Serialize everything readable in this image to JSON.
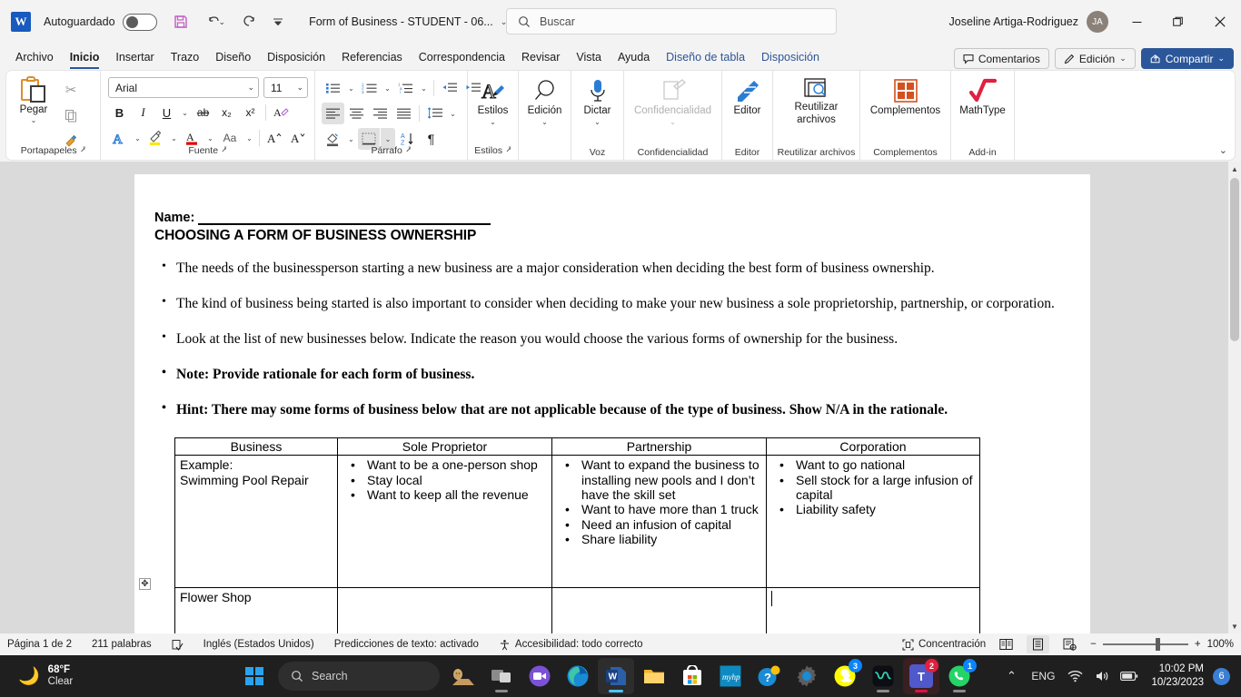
{
  "titlebar": {
    "app_logo": "word-logo",
    "autosave_label": "Autoguardado",
    "autosave_state": "off",
    "save_icon": "save-icon",
    "undo_icon": "undo-icon",
    "redo_icon": "redo-icon",
    "customize_icon": "customize-quick-access-icon",
    "document_title": "Form of Business - STUDENT - 06...",
    "search_placeholder": "Buscar",
    "user_name": "Joseline Artiga-Rodriguez",
    "user_initials": "JA",
    "minimize": "—",
    "restore": "❐",
    "close": "✕"
  },
  "ribbon_tabs": {
    "items": [
      {
        "label": "Archivo",
        "active": false,
        "contextual": false
      },
      {
        "label": "Inicio",
        "active": true,
        "contextual": false
      },
      {
        "label": "Insertar",
        "active": false,
        "contextual": false
      },
      {
        "label": "Trazo",
        "active": false,
        "contextual": false
      },
      {
        "label": "Diseño",
        "active": false,
        "contextual": false
      },
      {
        "label": "Disposición",
        "active": false,
        "contextual": false
      },
      {
        "label": "Referencias",
        "active": false,
        "contextual": false
      },
      {
        "label": "Correspondencia",
        "active": false,
        "contextual": false
      },
      {
        "label": "Revisar",
        "active": false,
        "contextual": false
      },
      {
        "label": "Vista",
        "active": false,
        "contextual": false
      },
      {
        "label": "Ayuda",
        "active": false,
        "contextual": false
      },
      {
        "label": "Diseño de tabla",
        "active": false,
        "contextual": true
      },
      {
        "label": "Disposición",
        "active": false,
        "contextual": true
      }
    ],
    "comments_label": "Comentarios",
    "editing_label": "Edición",
    "share_label": "Compartir",
    "accent_color": "#2b579a"
  },
  "ribbon": {
    "clipboard": {
      "group_label": "Portapapeles",
      "paste_label": "Pegar",
      "cut_icon": "cut-icon",
      "copy_icon": "copy-icon",
      "format_painter_icon": "format-painter-icon"
    },
    "font": {
      "group_label": "Fuente",
      "font_name": "Arial",
      "font_size": "11",
      "bold": "B",
      "italic": "I",
      "underline": "U",
      "strikethrough": "ab",
      "subscript": "x₂",
      "superscript": "x²",
      "clear_format_icon": "clear-formatting-icon",
      "text_effects_icon": "text-effects-icon",
      "highlight_icon": "text-highlight-icon",
      "font_color_icon": "font-color-icon",
      "change_case_label": "Aa",
      "grow_font_icon": "grow-font-icon",
      "shrink_font_icon": "shrink-font-icon",
      "highlight_color": "#ffe600",
      "font_color": "#e30000"
    },
    "paragraph": {
      "group_label": "Párrafo",
      "bullets_icon": "bullet-list-icon",
      "numbering_icon": "numbered-list-icon",
      "multilevel_icon": "multilevel-list-icon",
      "decrease_indent_icon": "decrease-indent-icon",
      "increase_indent_icon": "increase-indent-icon",
      "align_left_icon": "align-left-icon",
      "align_center_icon": "align-center-icon",
      "align_right_icon": "align-right-icon",
      "justify_icon": "justify-icon",
      "line_spacing_icon": "line-spacing-icon",
      "shading_icon": "shading-icon",
      "borders_icon": "borders-icon",
      "sort_icon": "sort-icon",
      "show_marks_icon": "show-formatting-marks-icon"
    },
    "styles": {
      "group_label": "Estilos",
      "button_label": "Estilos"
    },
    "editing": {
      "group_label": "",
      "button_label": "Edición"
    },
    "voice": {
      "group_label": "Voz",
      "button_label": "Dictar"
    },
    "sensitivity": {
      "group_label": "Confidencialidad",
      "button_label": "Confidencialidad",
      "disabled": true
    },
    "editor": {
      "group_label": "Editor",
      "button_label": "Editor"
    },
    "reuse": {
      "group_label": "Reutilizar archivos",
      "button_label": "Reutilizar\narchivos",
      "line1": "Reutilizar",
      "line2": "archivos"
    },
    "addins": {
      "group_label": "Complementos",
      "button_label": "Complementos"
    },
    "mathtype": {
      "group_label": "Add-in",
      "button_label": "MathType",
      "color": "#e02040"
    }
  },
  "document": {
    "name_label": "Name:",
    "title": "CHOOSING A FORM OF BUSINESS OWNERSHIP",
    "bullets": [
      {
        "text": "The needs of the businessperson starting a new business are a major consideration when deciding the best form of business ownership.",
        "bold": false
      },
      {
        "text": "The kind of business being started is also important to consider when deciding to make your new business a sole proprietorship, partnership, or corporation.",
        "bold": false
      },
      {
        "text": "Look at the list of new businesses below. Indicate the reason you would choose the various forms of ownership for the business.",
        "bold": false
      },
      {
        "text": "Note:  Provide rationale for each form of business.",
        "bold": true
      },
      {
        "text": "Hint:  There may some forms of business below that are not applicable because of the type of business.  Show N/A in the rationale.",
        "bold": true
      }
    ],
    "table": {
      "headers": [
        "Business",
        "Sole Proprietor",
        "Partnership",
        "Corporation"
      ],
      "rows": [
        {
          "business_lines": [
            "Example:",
            "Swimming Pool Repair"
          ],
          "sole_proprietor": [
            "Want to be a one-person shop",
            "Stay local",
            "Want to keep all the revenue"
          ],
          "partnership": [
            "Want to expand the business to installing new pools and I don’t have the skill set",
            "Want to have more than 1 truck",
            "Need an infusion of capital",
            "Share liability"
          ],
          "corporation": [
            "Want to go national",
            "Sell stock for a large infusion of capital",
            "Liability safety"
          ]
        },
        {
          "business_lines": [
            "Flower Shop"
          ],
          "sole_proprietor": [],
          "partnership": [],
          "corporation": [],
          "cursor_in": "corporation"
        }
      ]
    }
  },
  "statusbar": {
    "page": "Página 1 de 2",
    "words": "211 palabras",
    "proofing_icon": "proofing-icon",
    "language": "Inglés (Estados Unidos)",
    "text_predictions": "Predicciones de texto: activado",
    "accessibility": "Accesibilidad: todo correcto",
    "focus": "Concentración",
    "view_read_icon": "read-mode-icon",
    "view_print_icon": "print-layout-icon",
    "view_web_icon": "web-layout-icon",
    "zoom_minus": "−",
    "zoom_plus": "+",
    "zoom_level": "100%"
  },
  "taskbar": {
    "weather_temp": "68°F",
    "weather_cond": "Clear",
    "weather_icon": "moon-icon",
    "start_icon": "windows-start-icon",
    "search_placeholder": "Search",
    "apps": [
      {
        "name": "sphinx-widget-icon",
        "badge": null
      },
      {
        "name": "task-view-icon",
        "badge": null
      },
      {
        "name": "zoom-icon",
        "badge": null
      },
      {
        "name": "microsoft-edge-icon",
        "badge": null
      },
      {
        "name": "microsoft-word-icon",
        "badge": null,
        "active": true
      },
      {
        "name": "file-explorer-icon",
        "badge": null
      },
      {
        "name": "microsoft-store-icon",
        "badge": null
      },
      {
        "name": "myhp-icon",
        "badge": null
      },
      {
        "name": "help-icon",
        "badge": null
      },
      {
        "name": "settings-icon",
        "badge": null
      },
      {
        "name": "snapchat-icon",
        "badge": "3"
      },
      {
        "name": "webex-icon",
        "badge": null
      },
      {
        "name": "microsoft-teams-icon",
        "badge": "2"
      },
      {
        "name": "whatsapp-icon",
        "badge": "1"
      }
    ],
    "tray": {
      "show_hidden_icon": "chevron-up-icon",
      "language": "ENG",
      "wifi_icon": "wifi-icon",
      "volume_icon": "volume-icon",
      "battery_icon": "battery-icon",
      "time": "10:02 PM",
      "date": "10/23/2023",
      "notification_count": "6"
    }
  }
}
